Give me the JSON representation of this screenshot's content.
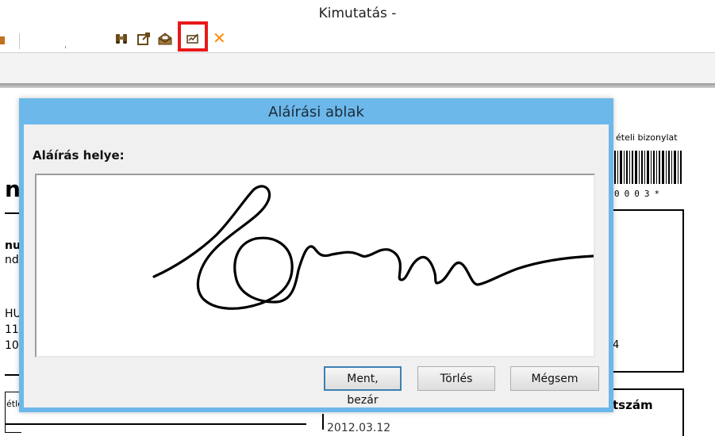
{
  "window": {
    "title": "Kimutatás -"
  },
  "toolbar": {
    "search_value": "",
    "icons": [
      "binoculars-icon",
      "export-icon",
      "mail-icon",
      "sign-icon",
      "close-icon"
    ],
    "highlight_color": "#e8191a",
    "close_symbol": "✕"
  },
  "document": {
    "letter": "n",
    "bizonylat_fragment": "ételi bizonylat",
    "barcode_digits": "0003*",
    "digit_four": "4",
    "tszam_fragment": "tszám",
    "bottom_fragment": "2012.03.12",
    "left_fragments": [
      "nu",
      "ndı",
      "HU",
      "11",
      "10",
      "étle"
    ]
  },
  "dialog": {
    "title": "Aláírási ablak",
    "signature_label": "Aláírás helye:",
    "buttons": {
      "save": "Ment, bezár",
      "clear": "Törlés",
      "cancel": "Mégsem"
    },
    "accent_color": "#6cb8ea"
  }
}
